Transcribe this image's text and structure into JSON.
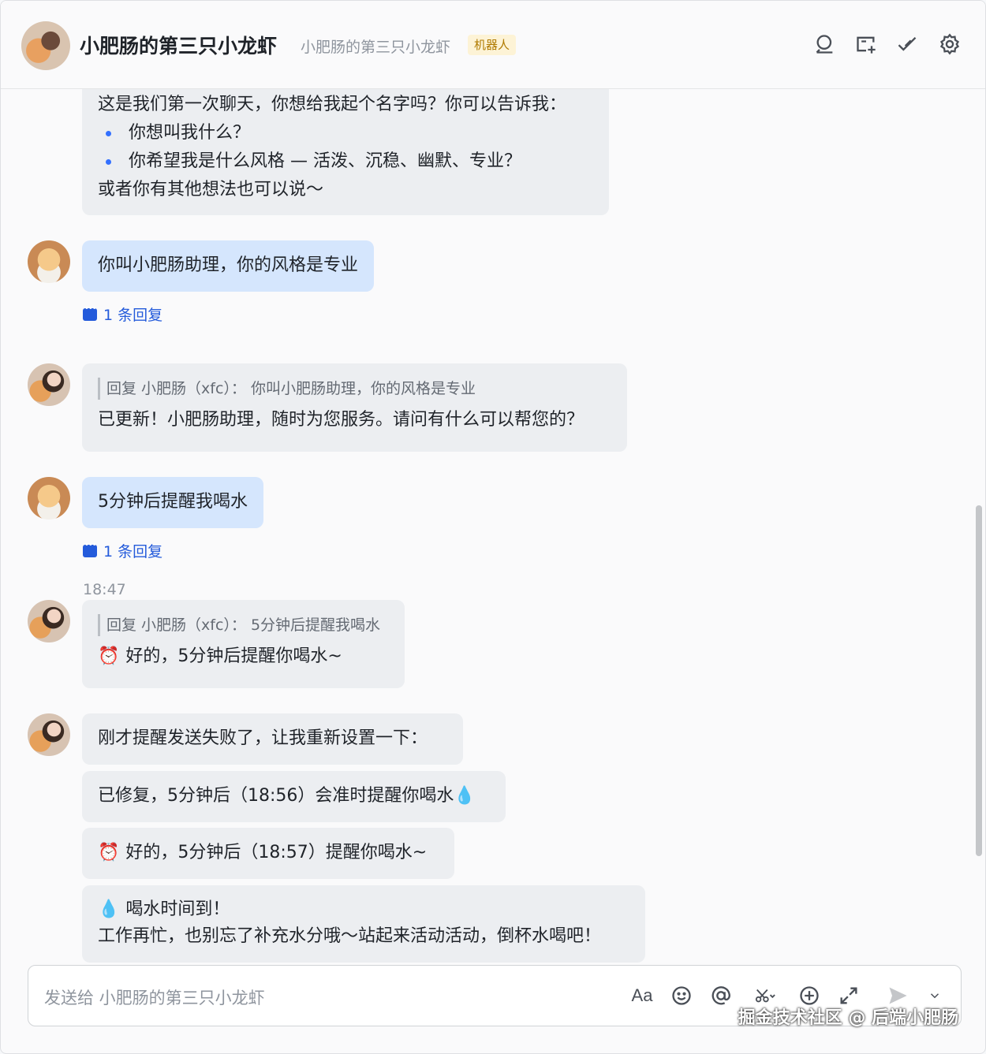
{
  "header": {
    "title": "小肥肠的第三只小龙虾",
    "subtitle": "小肥肠的第三只小龙虾",
    "badge": "机器人",
    "icons": [
      "search-icon",
      "add-tab-icon",
      "check-icon",
      "settings-icon"
    ]
  },
  "messages": {
    "m1": {
      "line1": "这是我们第一次聊天，你想给我起个名字吗？你可以告诉我：",
      "bullet1": "你想叫我什么？",
      "bullet2": "你希望我是什么风格 — 活泼、沉稳、幽默、专业？",
      "line2": "或者你有其他想法也可以说～"
    },
    "m2": {
      "text": "你叫小肥肠助理，你的风格是专业",
      "reply_count": "1 条回复"
    },
    "m3": {
      "quote": "回复 小肥肠（xfc）： 你叫小肥肠助理，你的风格是专业",
      "text": "已更新！小肥肠助理，随时为您服务。请问有什么可以帮您的？"
    },
    "m4": {
      "text": "5分钟后提醒我喝水",
      "reply_count": "1 条回复"
    },
    "timestamp": "18:47",
    "m5": {
      "quote": "回复 小肥肠（xfc）： 5分钟后提醒我喝水",
      "emoji": "⏰",
      "text": "好的，5分钟后提醒你喝水~"
    },
    "m6": {
      "text": "刚才提醒发送失败了，让我重新设置一下："
    },
    "m7": {
      "text": "已修复，5分钟后（18:56）会准时提醒你喝水",
      "emoji": "💧"
    },
    "m8": {
      "emoji": "⏰",
      "text": "好的，5分钟后（18:57）提醒你喝水~"
    },
    "m9": {
      "emoji": "💧",
      "line1": "喝水时间到！",
      "line2": "工作再忙，也别忘了补充水分哦～站起来活动活动，倒杯水喝吧！"
    }
  },
  "composer": {
    "placeholder": "发送给 小肥肠的第三只小龙虾",
    "tools": [
      "font-format-icon",
      "emoji-icon",
      "mention-icon",
      "scissors-icon",
      "add-icon",
      "expand-icon",
      "send-icon",
      "chevron-down-icon"
    ],
    "format_label": "Aa"
  },
  "watermark": "掘金技术社区 @ 后端小肥肠"
}
